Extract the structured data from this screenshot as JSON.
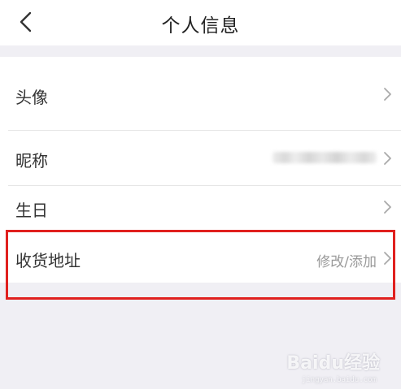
{
  "header": {
    "title": "个人信息",
    "back_icon": "chevron-left-icon"
  },
  "rows": [
    {
      "label": "头像",
      "value": "",
      "arrow_icon": "chevron-right-icon"
    },
    {
      "label": "昵称",
      "value": "",
      "value_blurred": true,
      "arrow_icon": "chevron-right-icon"
    },
    {
      "label": "生日",
      "value": "",
      "arrow_icon": "chevron-right-icon"
    },
    {
      "label": "收货地址",
      "value": "修改/添加",
      "arrow_icon": "chevron-right-icon",
      "highlighted": true
    }
  ],
  "watermark": {
    "logo": "Baidu经验",
    "url": "jingyan.baidu.com"
  },
  "colors": {
    "background": "#f0eff4",
    "highlight_border": "#e0201e",
    "label_text": "#333333",
    "value_text": "#999999"
  }
}
